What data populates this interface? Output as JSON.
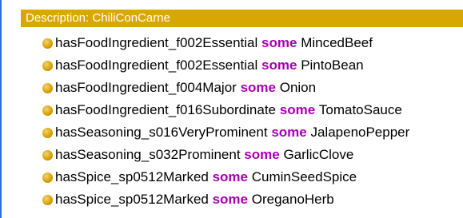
{
  "panel": {
    "title": "Description: ChiliConCarne"
  },
  "colors": {
    "header_bg": "#d9a800",
    "keyword": "#a600b0",
    "bullet": "#d9a400",
    "left_edge": "#2f6fd6"
  },
  "axioms": [
    {
      "property": "hasFoodIngredient_f002Essential",
      "keyword": "some",
      "filler": "MincedBeef"
    },
    {
      "property": "hasFoodIngredient_f002Essential",
      "keyword": "some",
      "filler": "PintoBean"
    },
    {
      "property": "hasFoodIngredient_f004Major",
      "keyword": "some",
      "filler": "Onion"
    },
    {
      "property": "hasFoodIngredient_f016Subordinate",
      "keyword": "some",
      "filler": "TomatoSauce"
    },
    {
      "property": "hasSeasoning_s016VeryProminent",
      "keyword": "some",
      "filler": "JalapenoPepper"
    },
    {
      "property": "hasSeasoning_s032Prominent",
      "keyword": "some",
      "filler": "GarlicClove"
    },
    {
      "property": "hasSpice_sp0512Marked",
      "keyword": "some",
      "filler": "CuminSeedSpice"
    },
    {
      "property": "hasSpice_sp0512Marked",
      "keyword": "some",
      "filler": "OreganoHerb"
    }
  ]
}
